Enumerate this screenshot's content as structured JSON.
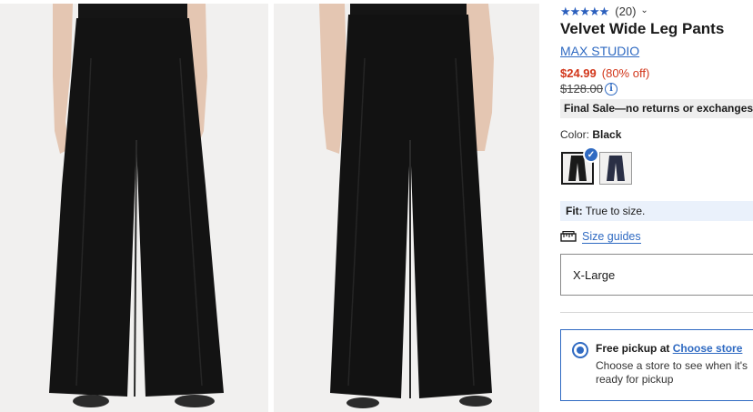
{
  "product": {
    "rating_stars": 5,
    "review_count": "(20)",
    "title": "Velvet Wide Leg Pants",
    "brand": "MAX STUDIO",
    "sale_price": "$24.99",
    "discount": "(80% off)",
    "original_price": "$128.00",
    "final_sale_notice": "Final Sale—no returns or exchanges"
  },
  "color": {
    "label": "Color:",
    "selected": "Black",
    "swatches": [
      {
        "name": "Black",
        "hex": "#1a1a1a",
        "selected": true
      },
      {
        "name": "Navy",
        "hex": "#2a2f45",
        "selected": false
      }
    ]
  },
  "fit": {
    "label": "Fit:",
    "value": "True to size."
  },
  "size_guides": {
    "label": "Size guides",
    "icon": "ruler-icon"
  },
  "size_select": {
    "value": "X-Large"
  },
  "pickup": {
    "prefix": "Free pickup at ",
    "link": "Choose store",
    "description": "Choose a store to see when it's ready for pickup"
  },
  "colors": {
    "accent": "#2f6ac2",
    "sale": "#d2361a",
    "star": "#2b5fbd"
  }
}
